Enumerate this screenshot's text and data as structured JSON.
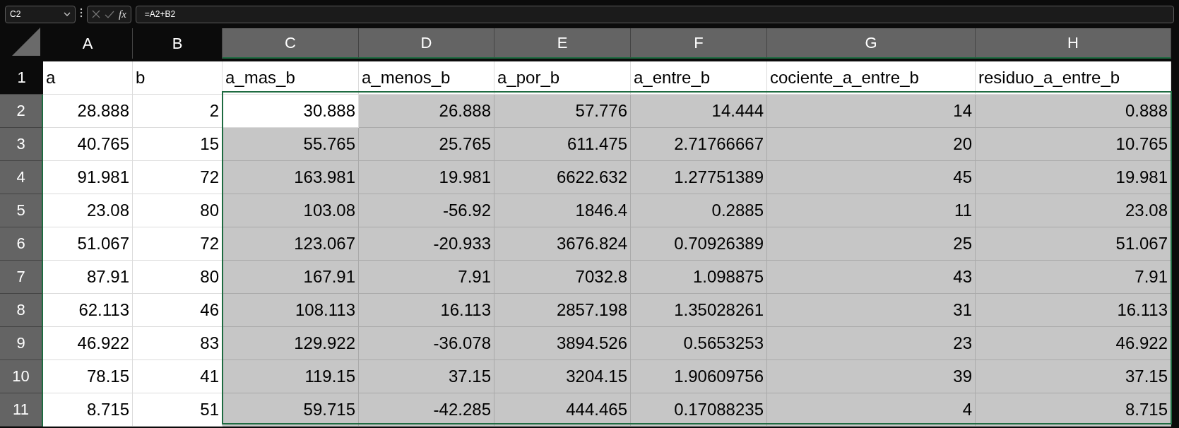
{
  "name_box": {
    "value": "C2"
  },
  "formula_bar": {
    "fx": "fx",
    "value": "=A2+B2"
  },
  "columns": [
    {
      "label": "A",
      "selected": false
    },
    {
      "label": "B",
      "selected": false
    },
    {
      "label": "C",
      "selected": true
    },
    {
      "label": "D",
      "selected": true
    },
    {
      "label": "E",
      "selected": true
    },
    {
      "label": "F",
      "selected": true
    },
    {
      "label": "G",
      "selected": true
    },
    {
      "label": "H",
      "selected": true
    }
  ],
  "rows": [
    {
      "number": "1",
      "selected": false,
      "cells": [
        "a",
        "b",
        "a_mas_b",
        "a_menos_b",
        "a_por_b",
        "a_entre_b",
        "cociente_a_entre_b",
        "residuo_a_entre_b"
      ]
    },
    {
      "number": "2",
      "selected": true,
      "cells": [
        "28.888",
        "2",
        "30.888",
        "26.888",
        "57.776",
        "14.444",
        "14",
        "0.888"
      ]
    },
    {
      "number": "3",
      "selected": true,
      "cells": [
        "40.765",
        "15",
        "55.765",
        "25.765",
        "611.475",
        "2.71766667",
        "20",
        "10.765"
      ]
    },
    {
      "number": "4",
      "selected": true,
      "cells": [
        "91.981",
        "72",
        "163.981",
        "19.981",
        "6622.632",
        "1.27751389",
        "45",
        "19.981"
      ]
    },
    {
      "number": "5",
      "selected": true,
      "cells": [
        "23.08",
        "80",
        "103.08",
        "-56.92",
        "1846.4",
        "0.2885",
        "11",
        "23.08"
      ]
    },
    {
      "number": "6",
      "selected": true,
      "cells": [
        "51.067",
        "72",
        "123.067",
        "-20.933",
        "3676.824",
        "0.70926389",
        "25",
        "51.067"
      ]
    },
    {
      "number": "7",
      "selected": true,
      "cells": [
        "87.91",
        "80",
        "167.91",
        "7.91",
        "7032.8",
        "1.098875",
        "43",
        "7.91"
      ]
    },
    {
      "number": "8",
      "selected": true,
      "cells": [
        "62.113",
        "46",
        "108.113",
        "16.113",
        "2857.198",
        "1.35028261",
        "31",
        "16.113"
      ]
    },
    {
      "number": "9",
      "selected": true,
      "cells": [
        "46.922",
        "83",
        "129.922",
        "-36.078",
        "3894.526",
        "0.5653253",
        "23",
        "46.922"
      ]
    },
    {
      "number": "10",
      "selected": true,
      "cells": [
        "78.15",
        "41",
        "119.15",
        "37.15",
        "3204.15",
        "1.90609756",
        "39",
        "37.15"
      ]
    },
    {
      "number": "11",
      "selected": true,
      "cells": [
        "8.715",
        "51",
        "59.715",
        "-42.285",
        "444.465",
        "0.17088235",
        "4",
        "8.715"
      ]
    }
  ]
}
